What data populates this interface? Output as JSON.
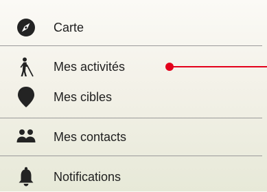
{
  "menu": {
    "items": [
      {
        "label": "Carte",
        "icon": "compass-icon"
      },
      {
        "label": "Mes activités",
        "icon": "blind-person-icon"
      },
      {
        "label": "Mes cibles",
        "icon": "target-marker-icon"
      },
      {
        "label": "Mes contacts",
        "icon": "contacts-group-icon"
      },
      {
        "label": "Notifications",
        "icon": "bell-icon"
      }
    ]
  },
  "colors": {
    "accent": "#e3001b",
    "divider": "#9a9a9a",
    "icon": "#232323"
  }
}
